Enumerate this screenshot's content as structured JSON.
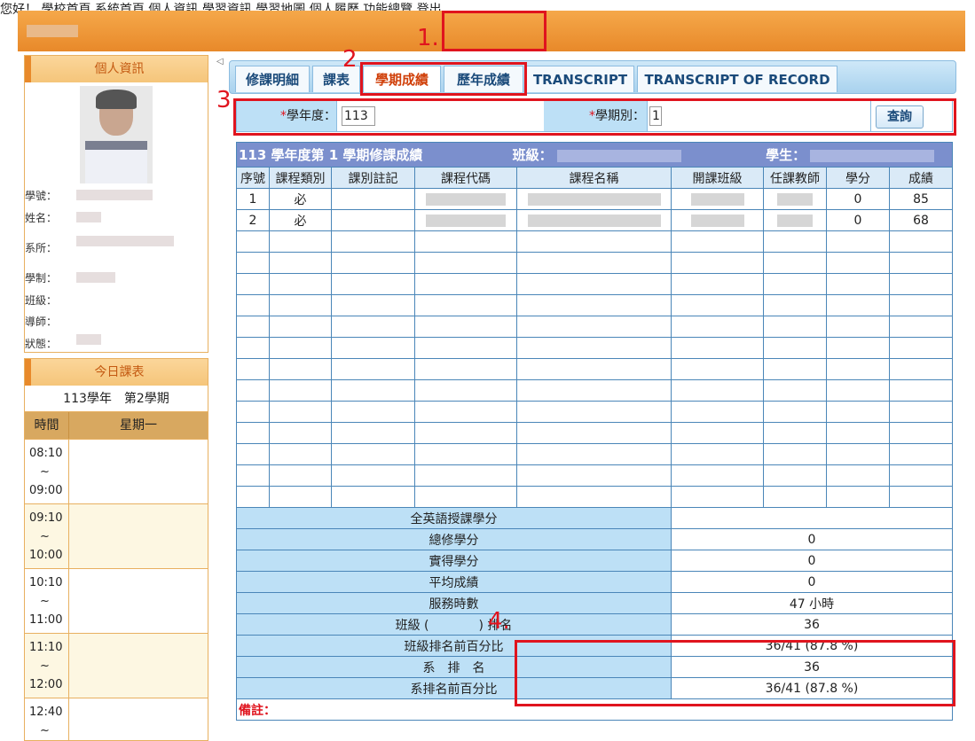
{
  "topbar": {
    "greeting": "您好！",
    "nav": [
      "學校首頁",
      "系統首頁",
      "個人資訊",
      "學習資訊",
      "學習地圖",
      "個人履歷",
      "功能總覽",
      "登出"
    ]
  },
  "annotations": [
    "1.",
    "2",
    "3",
    "4."
  ],
  "profile": {
    "title": "個人資訊",
    "fields": [
      "學號：",
      "姓名：",
      "系所：",
      "學制：",
      "班級：",
      "導師：",
      "狀態："
    ]
  },
  "schedule": {
    "title": "今日課表",
    "term": "113學年　第2學期",
    "col_time": "時間",
    "col_day": "星期一",
    "slots": [
      {
        "start": "08:10",
        "sep": "~",
        "end": "09:00"
      },
      {
        "start": "09:10",
        "sep": "~",
        "end": "10:00"
      },
      {
        "start": "10:10",
        "sep": "~",
        "end": "11:00"
      },
      {
        "start": "11:10",
        "sep": "~",
        "end": "12:00"
      },
      {
        "start": "12:40",
        "sep": "~",
        "end": ""
      }
    ]
  },
  "collapse_icon": "◁",
  "tabs": [
    "修課明細",
    "課表",
    "學期成績",
    "歷年成績",
    "TRANSCRIPT",
    "TRANSCRIPT OF RECORD"
  ],
  "query": {
    "year_label": "學年度：",
    "year_value": "113",
    "term_label": "學期別：",
    "term_value": "1",
    "button": "查詢",
    "required_mark": "*"
  },
  "grades": {
    "banner": "113 學年度第 1 學期修課成績",
    "class_label": "班級：",
    "student_label": "學生：",
    "headers": [
      "序號",
      "課程類別",
      "課別註記",
      "課程代碼",
      "課程名稱",
      "開課班級",
      "任課教師",
      "學分",
      "成績"
    ],
    "rows": [
      {
        "no": "1",
        "type": "必",
        "note": "",
        "credit": "0",
        "score": "85"
      },
      {
        "no": "2",
        "type": "必",
        "note": "",
        "credit": "0",
        "score": "68"
      }
    ],
    "summary": [
      {
        "label": "全英語授課學分",
        "value": ""
      },
      {
        "label": "總修學分",
        "value": "0"
      },
      {
        "label": "實得學分",
        "value": "0"
      },
      {
        "label": "平均成績",
        "value": "0"
      },
      {
        "label": "服務時數",
        "value": "47 小時"
      },
      {
        "label": "班級 (　　　　) 排名",
        "value": "36"
      },
      {
        "label": "班級排名前百分比",
        "value": "36/41 (87.8 %)"
      },
      {
        "label": "系　排　名",
        "value": "36"
      },
      {
        "label": "系排名前百分比",
        "value": "36/41 (87.8 %)"
      }
    ],
    "remark": "備註："
  },
  "colors": {
    "topbar": "#e8892a",
    "highlight": "#e0141e",
    "banner": "#7b8fcd",
    "label_bg": "#bde0f6"
  }
}
